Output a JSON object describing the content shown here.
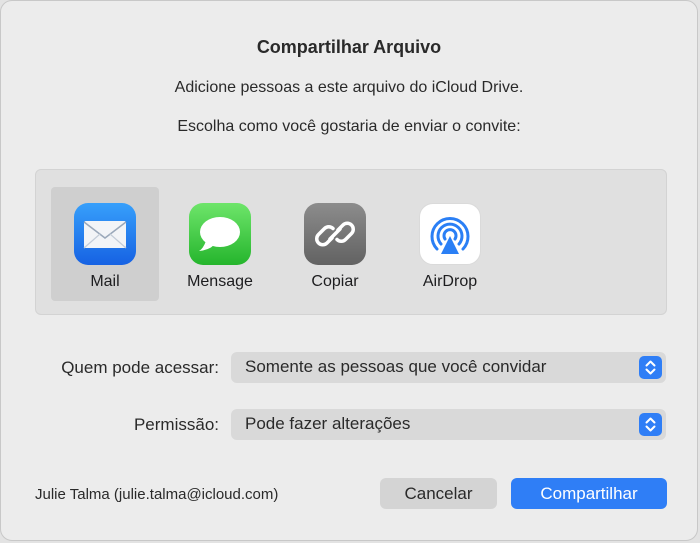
{
  "dialog": {
    "title": "Compartilhar Arquivo",
    "subtitle": "Adicione pessoas a este arquivo do iCloud Drive.",
    "prompt": "Escolha como você gostaria de enviar o convite:"
  },
  "share_options": [
    {
      "label": "Mail",
      "icon": "mail-icon",
      "selected": true
    },
    {
      "label": "Mensage",
      "icon": "messages-icon",
      "selected": false
    },
    {
      "label": "Copiar",
      "icon": "link-icon",
      "selected": false
    },
    {
      "label": "AirDrop",
      "icon": "airdrop-icon",
      "selected": false
    }
  ],
  "access": {
    "label": "Quem pode acessar:",
    "value": "Somente as pessoas que você convidar"
  },
  "permission": {
    "label": "Permissão:",
    "value": "Pode fazer alterações"
  },
  "account": "Julie Talma (julie.talma@icloud.com)",
  "buttons": {
    "cancel": "Cancelar",
    "share": "Compartilhar"
  },
  "colors": {
    "accent": "#2f7ef6",
    "background": "#ececec",
    "panel": "#e0e0e0",
    "selected": "#cfcfcf"
  }
}
